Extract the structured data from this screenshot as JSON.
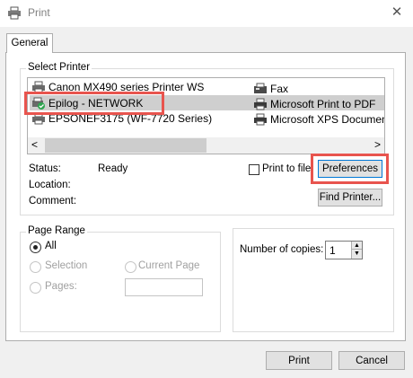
{
  "window": {
    "title": "Print",
    "close_glyph": "✕"
  },
  "tabs": [
    {
      "label": "General"
    }
  ],
  "select_printer": {
    "group_label": "Select Printer",
    "printers": [
      {
        "label": "Canon MX490 series Printer WS",
        "icon": "printer-icon"
      },
      {
        "label": "Epilog - NETWORK",
        "icon": "network-printer-icon",
        "selected": true
      },
      {
        "label": "EPSONEF3175 (WF-7720 Series)",
        "icon": "printer-icon"
      },
      {
        "label": "Fax",
        "icon": "fax-icon"
      },
      {
        "label": "Microsoft Print to PDF",
        "icon": "printer-icon"
      },
      {
        "label": "Microsoft XPS Documen",
        "icon": "printer-icon"
      }
    ],
    "status_label": "Status:",
    "status_value": "Ready",
    "location_label": "Location:",
    "comment_label": "Comment:",
    "print_to_file_label": "Print to file",
    "preferences_label": "Preferences",
    "find_printer_label": "Find Printer...",
    "scroll_left": "<",
    "scroll_right": ">"
  },
  "page_range": {
    "group_label": "Page Range",
    "all_label": "All",
    "selection_label": "Selection",
    "current_page_label": "Current Page",
    "pages_label": "Pages:",
    "pages_value": ""
  },
  "copies": {
    "label": "Number of copies:",
    "value": "1",
    "up": "▲",
    "down": "▼"
  },
  "footer": {
    "print_label": "Print",
    "cancel_label": "Cancel"
  },
  "colors": {
    "highlight": "#e8544e",
    "selection": "#cfcfcf",
    "focus_border": "#0078d7"
  }
}
